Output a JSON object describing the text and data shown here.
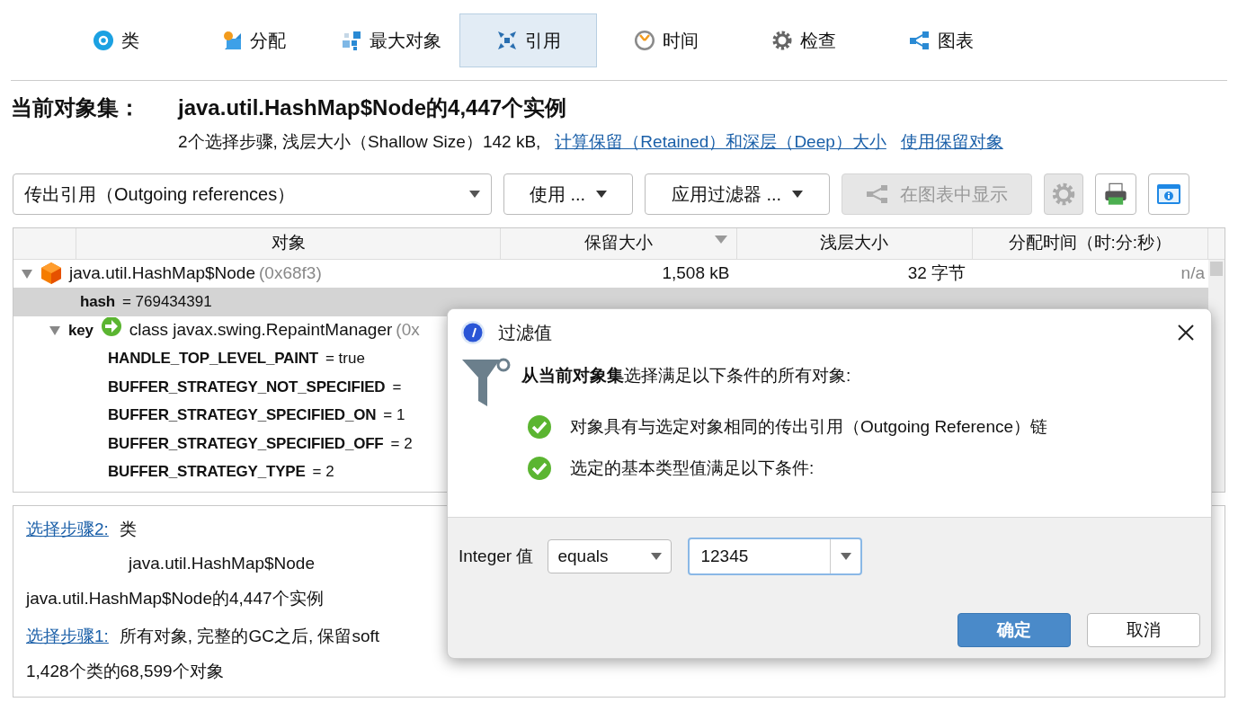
{
  "tabs": [
    {
      "label": "类",
      "selected": false
    },
    {
      "label": "分配",
      "selected": false
    },
    {
      "label": "最大对象",
      "selected": false
    },
    {
      "label": "引用",
      "selected": true
    },
    {
      "label": "时间",
      "selected": false
    },
    {
      "label": "检查",
      "selected": false
    },
    {
      "label": "图表",
      "selected": false
    }
  ],
  "header": {
    "label": "当前对象集：",
    "title": "java.util.HashMap$Node的4,447个实例",
    "summary": "2个选择步骤, 浅层大小（Shallow Size）142 kB,",
    "links": [
      "计算保留（Retained）和深层（Deep）大小",
      "使用保留对象"
    ]
  },
  "toolbar": {
    "view_select": "传出引用（Outgoing references）",
    "buttons": [
      {
        "label": "使用 ...",
        "disabled": false
      },
      {
        "label": "应用过滤器 ...",
        "disabled": false
      },
      {
        "label": "在图表中显示",
        "disabled": true
      }
    ]
  },
  "table": {
    "columns": [
      {
        "label": "对象",
        "sorted": false
      },
      {
        "label": "保留大小",
        "sorted": true
      },
      {
        "label": "浅层大小",
        "sorted": false
      },
      {
        "label": "分配时间（时:分:秒）",
        "sorted": false
      }
    ],
    "rows": [
      {
        "kind": "object",
        "name": "java.util.HashMap$Node",
        "address": "(0x68f3)",
        "retained": "1,508 kB",
        "shallow": "32 字节",
        "alloc_time": "n/a",
        "expanded": true,
        "selected": false,
        "children": [
          {
            "kind": "field",
            "name": "hash",
            "value": "= 769434391",
            "selected": true
          },
          {
            "kind": "reference",
            "name": "key",
            "value": "class javax.swing.RepaintManager",
            "address": "(0x",
            "expanded": true,
            "selected": false,
            "children": [
              {
                "kind": "field",
                "name": "HANDLE_TOP_LEVEL_PAINT",
                "value": "= true",
                "selected": false
              },
              {
                "kind": "field",
                "name": "BUFFER_STRATEGY_NOT_SPECIFIED",
                "value": "=",
                "selected": false
              },
              {
                "kind": "field",
                "name": "BUFFER_STRATEGY_SPECIFIED_ON",
                "value": "= 1",
                "selected": false
              },
              {
                "kind": "field",
                "name": "BUFFER_STRATEGY_SPECIFIED_OFF",
                "value": "= 2",
                "selected": false
              },
              {
                "kind": "field",
                "name": "BUFFER_STRATEGY_TYPE",
                "value": "= 2",
                "selected": false
              }
            ]
          }
        ]
      }
    ]
  },
  "history": [
    {
      "link": "选择步骤2:",
      "text": "类",
      "detail": "java.util.HashMap$Node",
      "result": "java.util.HashMap$Node的4,447个实例"
    },
    {
      "link": "选择步骤1:",
      "text": "所有对象, 完整的GC之后, 保留soft",
      "result": "1,428个类的68,599个对象"
    }
  ],
  "dialog": {
    "title": "过滤值",
    "heading": "**从当前对象集**选择满足以下条件的所有对象:",
    "conditions": [
      "对象具有与选定对象相同的传出引用（Outgoing Reference）链",
      "选定的基本类型值满足以下条件:"
    ],
    "field_label": "Integer 值",
    "operator": "equals",
    "value": "12345",
    "buttons": [
      {
        "label": "确定",
        "primary": true
      },
      {
        "label": "取消",
        "primary": false
      }
    ]
  }
}
